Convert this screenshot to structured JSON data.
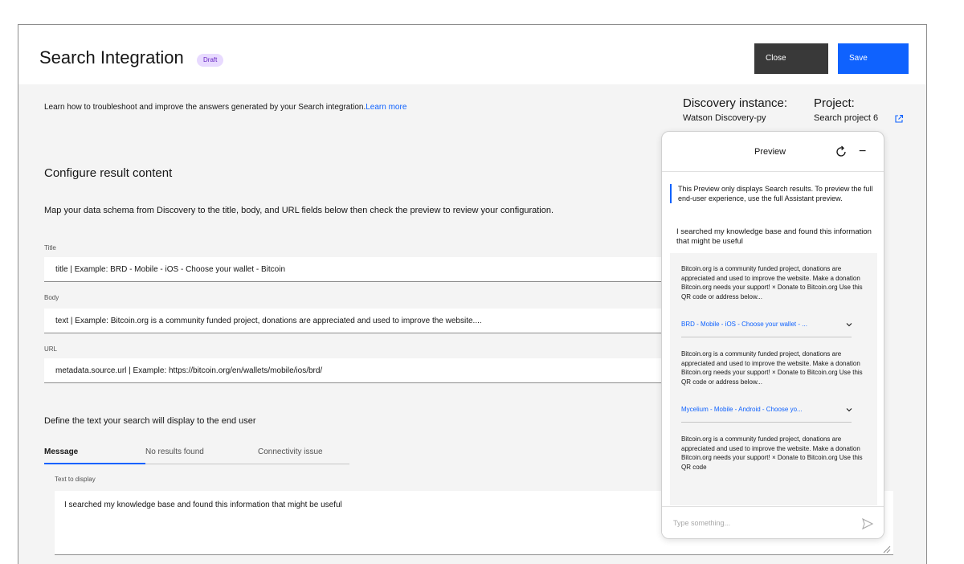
{
  "header": {
    "title": "Search Integration",
    "badge": "Draft",
    "close_label": "Close",
    "save_label": "Save"
  },
  "intro": {
    "text": "Learn how to troubleshoot and improve the answers generated by your Search integration.",
    "link": "Learn more"
  },
  "instance": {
    "discovery_label": "Discovery instance:",
    "discovery_value": "Watson Discovery-py",
    "project_label": "Project:",
    "project_value": "Search project 6"
  },
  "configure": {
    "title": "Configure result content",
    "description": "Map your data schema from Discovery to the title, body, and URL fields below then check the preview to review your configuration.",
    "fields": [
      {
        "label": "Title",
        "value": "title   |   Example: BRD - Mobile - iOS - Choose your wallet - Bitcoin"
      },
      {
        "label": "Body",
        "value": "text   |   Example: Bitcoin.org is a community funded project, donations are appreciated and used to improve the website...."
      },
      {
        "label": "URL",
        "value": "metadata.source.url   |   Example: https://bitcoin.org/en/wallets/mobile/ios/brd/"
      }
    ]
  },
  "define": {
    "title": "Define the text your search will display to the end user",
    "tabs": [
      "Message",
      "No results found",
      "Connectivity issue"
    ],
    "active_tab": "Message",
    "text_label": "Text to display",
    "text_value": "I searched my knowledge base and found this information that might be useful"
  },
  "preview": {
    "title": "Preview",
    "note": "This Preview only displays Search results. To preview the full end-user experience, use the full Assistant preview.",
    "reply": "I searched my knowledge base and found this information that might be useful",
    "results": [
      {
        "text": "Bitcoin.org is a community funded project, donations are appreciated and used to improve the website. Make a donation Bitcoin.org needs your support! × Donate to Bitcoin.org Use this QR code or address below...",
        "link": "BRD - Mobile - iOS - Choose your wallet - ..."
      },
      {
        "text": "Bitcoin.org is a community funded project, donations are appreciated and used to improve the website. Make a donation Bitcoin.org needs your support! × Donate to Bitcoin.org Use this QR code or address below...",
        "link": "Mycelium - Mobile - Android - Choose yo..."
      },
      {
        "text": "Bitcoin.org is a community funded project, donations are appreciated and used to improve the website. Make a donation Bitcoin.org needs your support! × Donate to Bitcoin.org Use this QR code",
        "link": ""
      }
    ],
    "input_placeholder": "Type something..."
  },
  "icons": {
    "external": "external-link-icon",
    "refresh": "refresh-icon",
    "minimize": "minimize-icon",
    "chevron": "chevron-down-icon",
    "send": "send-icon",
    "resize": "resize-handle-icon"
  },
  "colors": {
    "primary": "#0f62fe",
    "close_button": "#393939",
    "badge_bg": "#e8daff",
    "badge_text": "#6929c4",
    "panel_bg": "#f4f4f4"
  }
}
